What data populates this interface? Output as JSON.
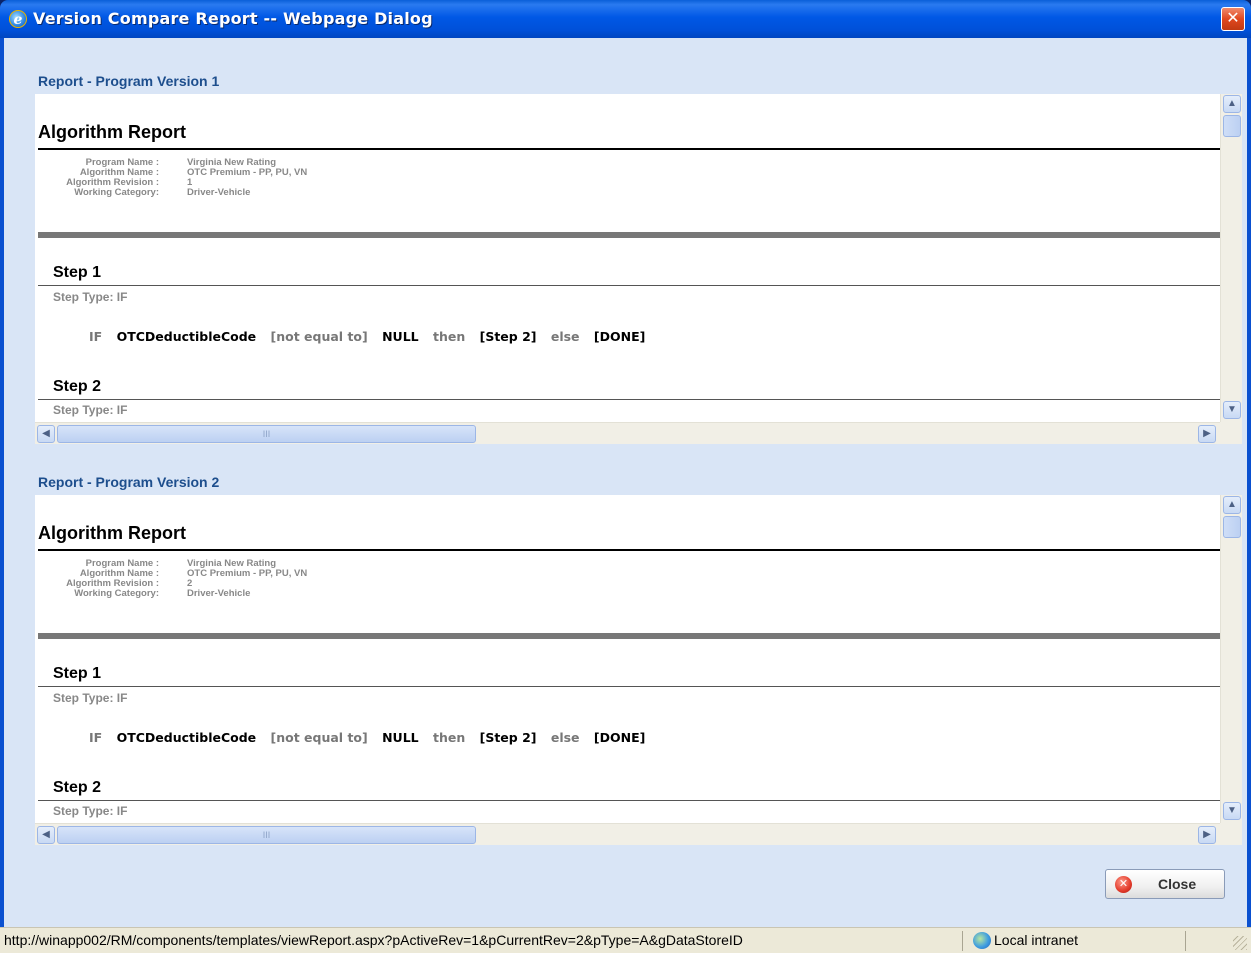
{
  "window": {
    "title": "Version Compare Report -- Webpage Dialog",
    "close_glyph": "✕"
  },
  "panes": [
    {
      "section_title": "Report - Program Version 1",
      "report_title": "Algorithm Report",
      "meta_labels": [
        "Program Name :",
        "Algorithm Name :",
        "Algorithm Revision :",
        "Working Category:"
      ],
      "meta_values": [
        "Virginia New Rating",
        "OTC Premium - PP, PU, VN",
        "1",
        "Driver-Vehicle"
      ],
      "steps": [
        {
          "title": "Step 1",
          "type": "Step Type: IF",
          "expr": [
            "IF",
            "OTCDeductibleCode",
            "[not equal to]",
            "NULL",
            "then",
            "[Step 2]",
            "else",
            "[DONE]"
          ]
        },
        {
          "title": "Step 2",
          "type": "Step Type: IF"
        }
      ]
    },
    {
      "section_title": "Report - Program Version 2",
      "report_title": "Algorithm Report",
      "meta_labels": [
        "Program Name :",
        "Algorithm Name :",
        "Algorithm Revision :",
        "Working Category:"
      ],
      "meta_values": [
        "Virginia New Rating",
        "OTC Premium - PP, PU, VN",
        "2",
        "Driver-Vehicle"
      ],
      "steps": [
        {
          "title": "Step 1",
          "type": "Step Type: IF",
          "expr": [
            "IF",
            "OTCDeductibleCode",
            "[not equal to]",
            "NULL",
            "then",
            "[Step 2]",
            "else",
            "[DONE]"
          ]
        },
        {
          "title": "Step 2",
          "type": "Step Type: IF"
        }
      ]
    }
  ],
  "scroll": {
    "up": "▲",
    "down": "▼",
    "left": "◀",
    "right": "▶",
    "grip": "III"
  },
  "close_button": {
    "label": "Close",
    "icon": "✕"
  },
  "status": {
    "url": "http://winapp002/RM/components/templates/viewReport.aspx?pActiveRev=1&pCurrentRev=2&pType=A&gDataStoreID",
    "zone": "Local intranet"
  }
}
